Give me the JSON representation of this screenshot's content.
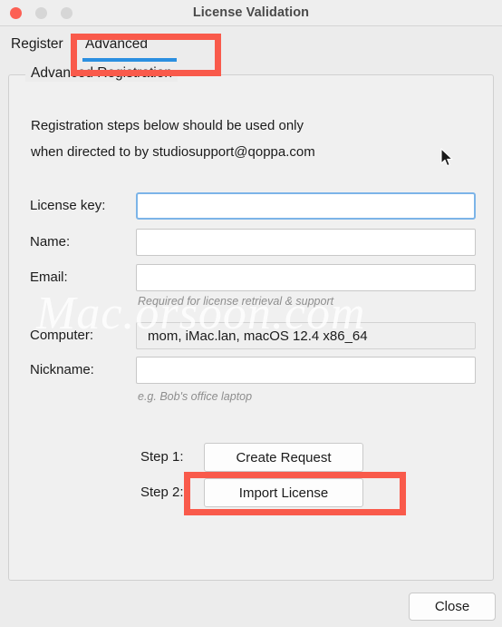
{
  "window": {
    "title": "License Validation",
    "traffic_lights": [
      {
        "name": "close",
        "color": "#fc6054"
      },
      {
        "name": "minimize",
        "color": "#d6d6d6"
      },
      {
        "name": "zoom",
        "color": "#d6d6d6"
      }
    ]
  },
  "tabs": [
    {
      "id": "register",
      "label": "Register",
      "selected": false
    },
    {
      "id": "advanced",
      "label": "Advanced",
      "selected": true
    }
  ],
  "group": {
    "title": "Advanced Registration",
    "intro_line1": "Registration steps below should be used only",
    "intro_line2": "when directed to by studiosupport@qoppa.com"
  },
  "form": {
    "license_key": {
      "label": "License key:",
      "value": "",
      "placeholder": "",
      "focused": true
    },
    "name": {
      "label": "Name:",
      "value": "",
      "placeholder": ""
    },
    "email": {
      "label": "Email:",
      "value": "",
      "placeholder": "",
      "hint": "Required for license retrieval & support"
    },
    "computer": {
      "label": "Computer:",
      "value": "mom, iMac.lan, macOS 12.4 x86_64",
      "readonly": true
    },
    "nickname": {
      "label": "Nickname:",
      "value": "",
      "placeholder": "",
      "hint": "e.g. Bob's office laptop"
    }
  },
  "steps": [
    {
      "label": "Step 1:",
      "button": "Create Request"
    },
    {
      "label": "Step 2:",
      "button": "Import License"
    }
  ],
  "footer": {
    "close_label": "Close"
  },
  "annotations": {
    "color": "#f95a4b",
    "boxes": [
      {
        "name": "advanced-tab-highlight"
      },
      {
        "name": "import-license-highlight"
      }
    ]
  },
  "watermark": {
    "text": "Mac.orsoon.com"
  }
}
